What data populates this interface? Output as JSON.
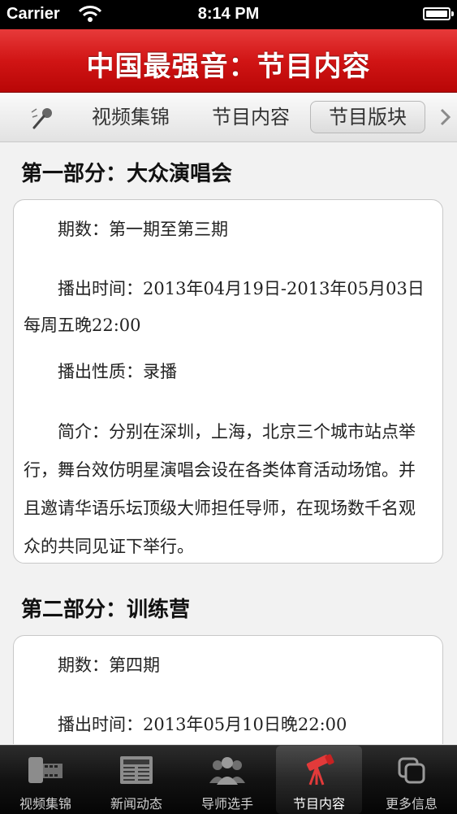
{
  "status_bar": {
    "carrier": "Carrier",
    "time": "8:14 PM"
  },
  "header": {
    "title": "中国最强音：节目内容"
  },
  "segment_tabs": {
    "items": [
      {
        "label": "视频集锦"
      },
      {
        "label": "节目内容"
      },
      {
        "label": "节目版块",
        "selected": true
      }
    ],
    "icon": "microphone-icon"
  },
  "sections": [
    {
      "title": "第一部分：大众演唱会",
      "paragraphs": [
        "期数：第一期至第三期",
        "播出时间：2013年04月19日-2013年05月03日每周五晚22:00",
        "播出性质：录播",
        "简介：分别在深圳，上海，北京三个城市站点举行，舞台效仿明星演唱会设在各类体育活动场馆。并且邀请华语乐坛顶级大师担任导师，在现场数千名观众的共同见证下举行。"
      ]
    },
    {
      "title": "第二部分：训练营",
      "paragraphs": [
        "期数：第四期",
        "播出时间：2013年05月10日晚22:00"
      ]
    }
  ],
  "tab_bar": {
    "items": [
      {
        "label": "视频集锦",
        "icon": "film-reel-icon"
      },
      {
        "label": "新闻动态",
        "icon": "newspaper-icon"
      },
      {
        "label": "导师选手",
        "icon": "people-icon"
      },
      {
        "label": "节目内容",
        "icon": "telescope-icon",
        "active": true
      },
      {
        "label": "更多信息",
        "icon": "more-icon"
      }
    ]
  },
  "colors": {
    "header_red": "#d11515",
    "tab_bar_dark": "#111111",
    "active_icon": "#e23a3a"
  }
}
